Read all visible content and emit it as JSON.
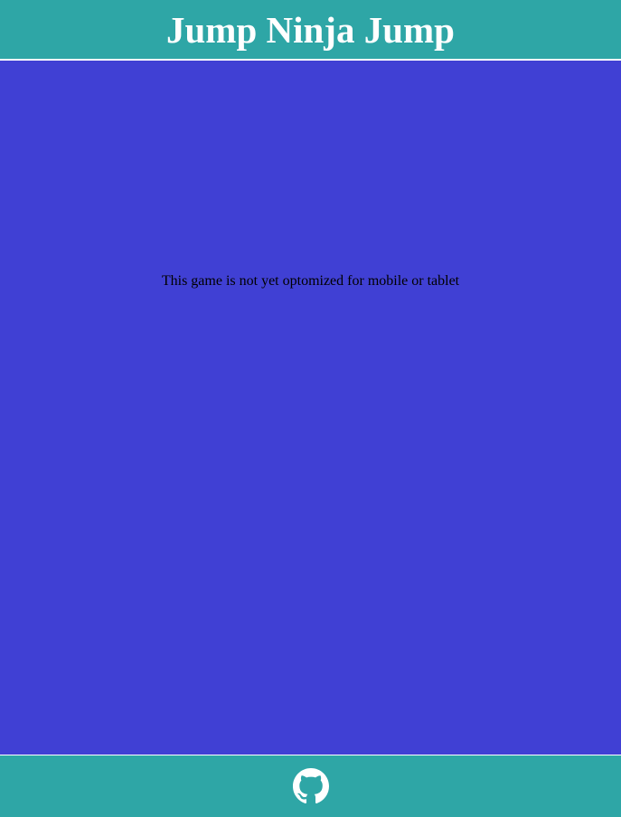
{
  "header": {
    "title": "Jump Ninja Jump"
  },
  "main": {
    "notice": "This game is not yet optomized for mobile or tablet"
  },
  "footer": {
    "icon": "github-icon"
  },
  "colors": {
    "header_bg": "#2ea6a6",
    "main_bg": "#4040d4",
    "footer_bg": "#2ea6a6",
    "title_text": "#ffffff",
    "notice_text": "#000000",
    "icon": "#ffffff"
  }
}
